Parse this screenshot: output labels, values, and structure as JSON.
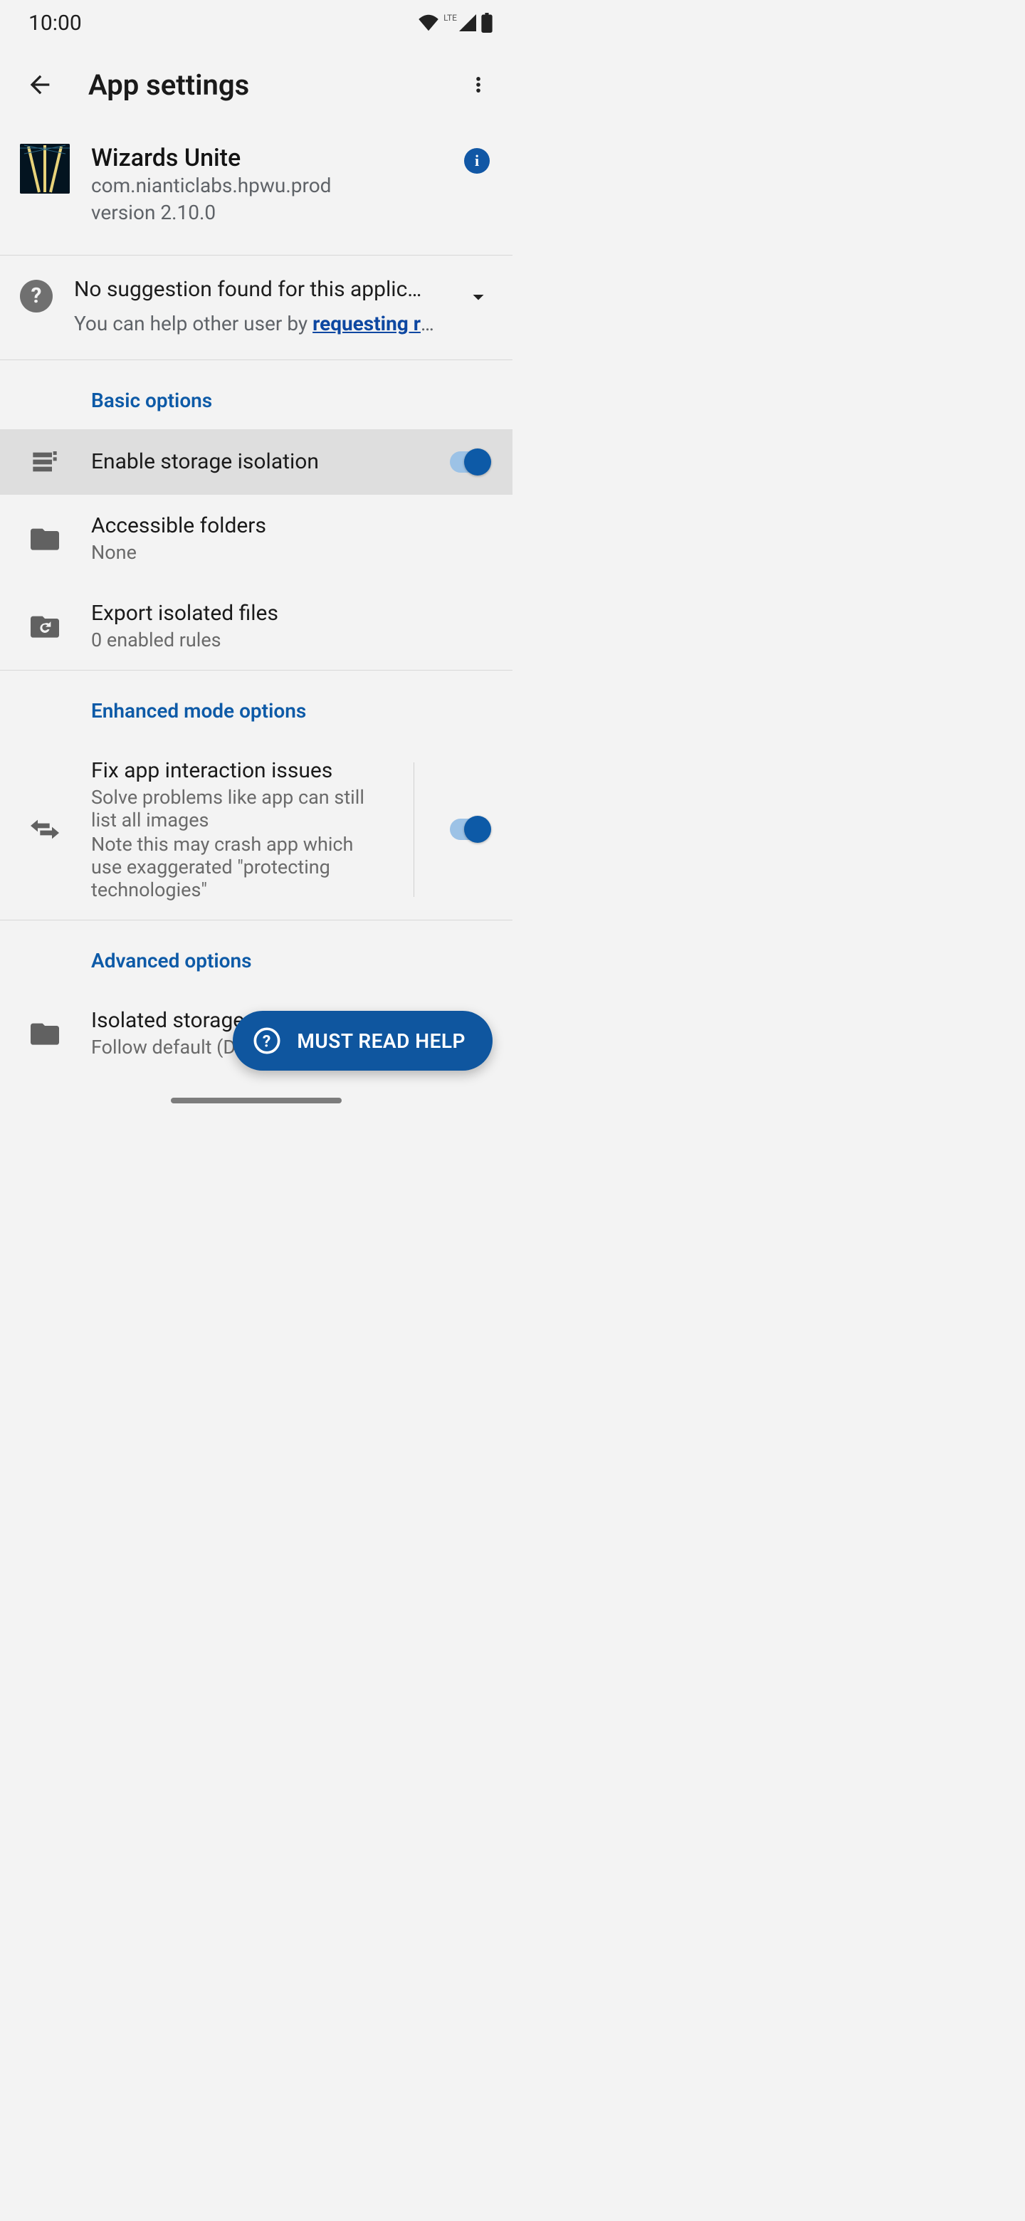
{
  "status": {
    "time": "10:00",
    "network_label": "LTE"
  },
  "appbar": {
    "title": "App settings"
  },
  "app": {
    "name": "Wizards Unite",
    "package": "com.nianticlabs.hpwu.prod",
    "version": "version 2.10.0"
  },
  "suggestion": {
    "title": "No suggestion found for this applic…",
    "help_prefix": "You can help other user by ",
    "help_link": "requesting rule with a s…"
  },
  "sections": {
    "basic": "Basic options",
    "enhanced": "Enhanced mode options",
    "advanced": "Advanced options"
  },
  "rows": {
    "enable_isolation": {
      "title": "Enable storage isolation",
      "on": true
    },
    "accessible": {
      "title": "Accessible folders",
      "sub": "None"
    },
    "export": {
      "title": "Export isolated files",
      "sub": "0 enabled rules"
    },
    "fix": {
      "title": "Fix app interaction issues",
      "sub1": "Solve problems like app can still list all images",
      "sub2": "Note this may crash app which use exaggerated \"protecting technologies\"",
      "on": true
    },
    "isolated_path": {
      "title": "Isolated storage",
      "sub": "Follow default (Data …"
    }
  },
  "fab": {
    "label": "MUST READ HELP"
  }
}
